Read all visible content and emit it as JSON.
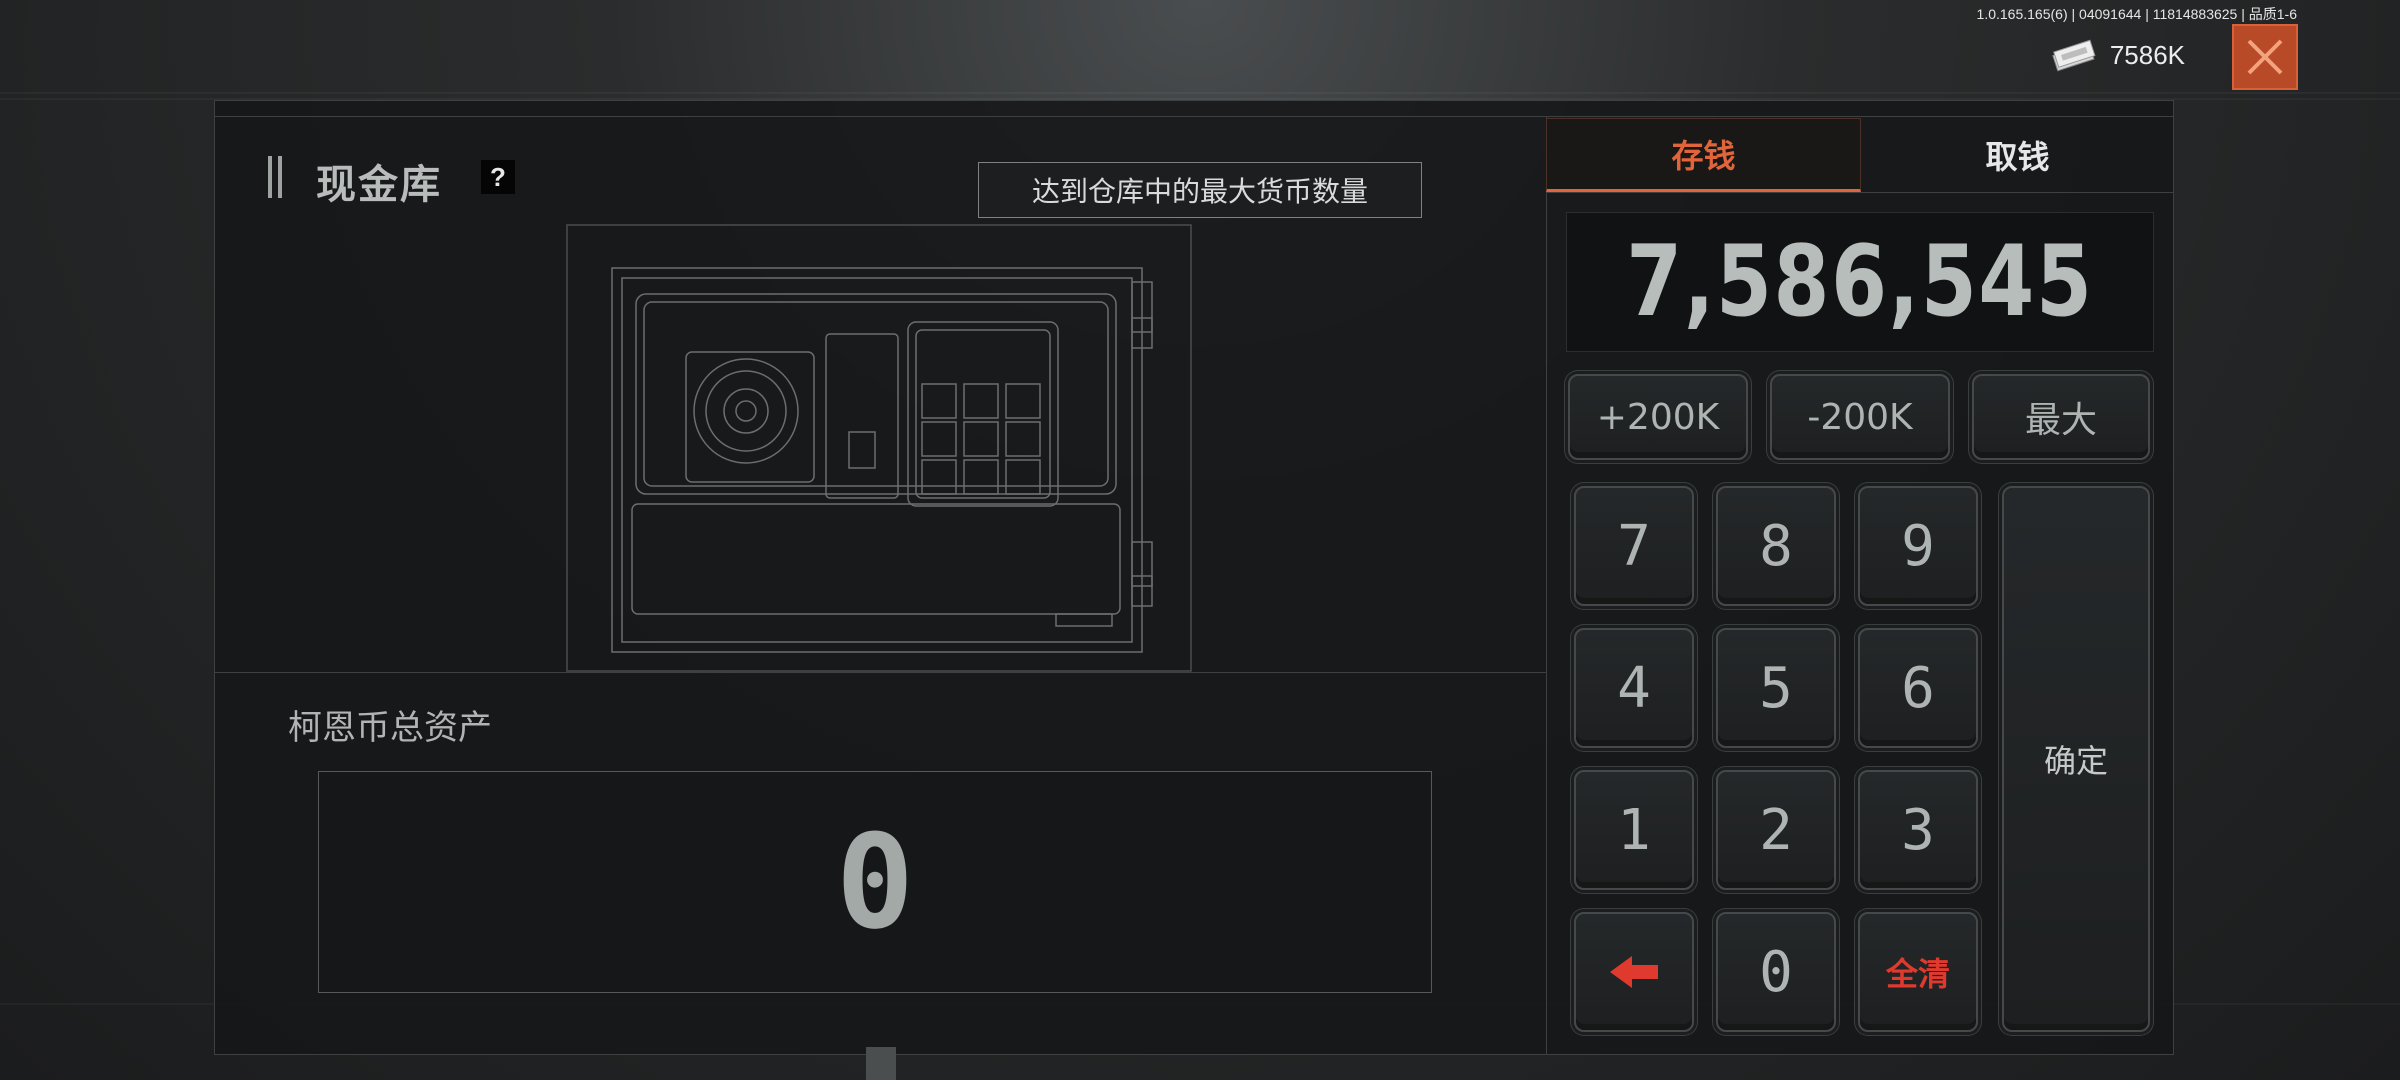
{
  "version_info": "1.0.165.165(6) | 04091644 | 11814883625 | 品质1-6",
  "header": {
    "currency_icon": "cash-stack-icon",
    "currency_amount": "7586K",
    "close_icon": "close-x-icon"
  },
  "vault": {
    "title": "现金库",
    "help_label": "?",
    "notice": "达到仓库中的最大货币数量",
    "safe_image": "safe-illustration",
    "assets_label": "柯恩币总资产",
    "assets_value": "0"
  },
  "tabs": [
    {
      "label": "存钱",
      "active": true
    },
    {
      "label": "取钱",
      "active": false
    }
  ],
  "amount_display": "7,586,545",
  "quick_buttons": [
    "+200K",
    "-200K",
    "最大"
  ],
  "keypad": {
    "digits": [
      "7",
      "8",
      "9",
      "4",
      "5",
      "6",
      "1",
      "2",
      "3"
    ],
    "zero": "0",
    "backspace_icon": "backspace-arrow-icon",
    "clear_label": "全清",
    "confirm_label": "确定"
  },
  "colors": {
    "accent": "#e0653a",
    "close_bg": "#b94a27",
    "danger": "#e03a2f"
  }
}
